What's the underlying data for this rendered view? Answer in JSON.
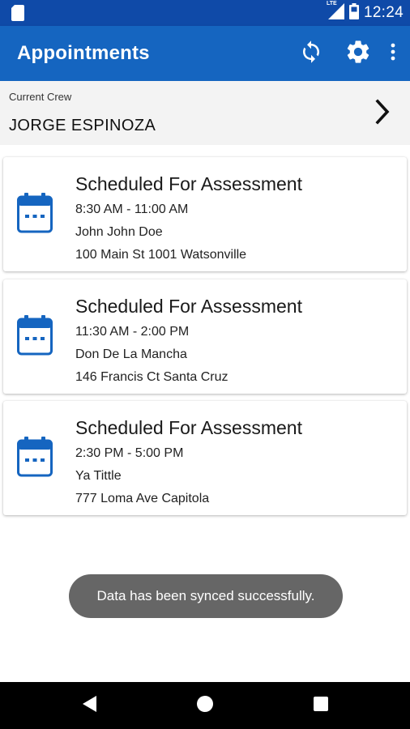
{
  "status_bar": {
    "time": "12:24",
    "network_label": "LTE",
    "icons": [
      "sd-card-icon",
      "lte-signal-icon",
      "battery-icon"
    ]
  },
  "app_bar": {
    "title": "Appointments",
    "actions": [
      "sync-icon",
      "settings-gear-icon",
      "more-vertical-icon"
    ]
  },
  "crew": {
    "label": "Current Crew",
    "name": "JORGE ESPINOZA",
    "icon": "chevron-right-icon"
  },
  "appointments": [
    {
      "title": "Scheduled For Assessment",
      "time": "8:30 AM - 11:00 AM",
      "name": "John John Doe",
      "address": "100 Main St 1001 Watsonville"
    },
    {
      "title": "Scheduled For Assessment",
      "time": "11:30 AM - 2:00 PM",
      "name": "Don De La Mancha",
      "address": "146 Francis Ct Santa Cruz"
    },
    {
      "title": "Scheduled For Assessment",
      "time": "2:30 PM - 5:00 PM",
      "name": "Ya Tittle",
      "address": "777 Loma Ave Capitola"
    }
  ],
  "toast": {
    "message": "Data has been synced successfully."
  },
  "nav_bar": {
    "buttons": [
      "back-icon",
      "home-icon",
      "recents-icon"
    ]
  },
  "colors": {
    "primary": "#1565c0",
    "primary_dark": "#0f4aa8",
    "icon_blue": "#1565c0",
    "toast_bg": "#666666"
  }
}
